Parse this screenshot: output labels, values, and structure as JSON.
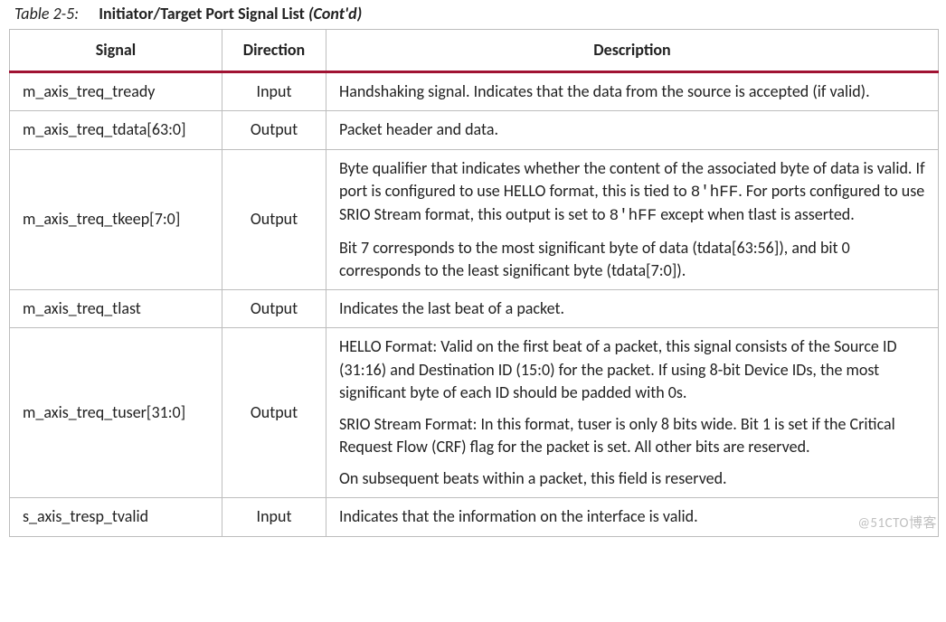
{
  "caption": {
    "label": "Table 2-5:",
    "title": "Initiator/Target Port Signal List",
    "contd": "(Cont'd)"
  },
  "headers": {
    "signal": "Signal",
    "direction": "Direction",
    "description": "Description"
  },
  "rows": [
    {
      "signal": "m_axis_treq_tready",
      "direction": "Input",
      "desc": [
        "Handshaking signal. Indicates that the data from the source is accepted (if valid)."
      ]
    },
    {
      "signal": "m_axis_treq_tdata[63:0]",
      "direction": "Output",
      "desc": [
        "Packet header and data."
      ]
    },
    {
      "signal": "m_axis_treq_tkeep[7:0]",
      "direction": "Output",
      "desc": [
        "Byte qualifier that indicates whether the content of the associated byte of data is valid. If port is configured to use HELLO format, this is tied to 8'hFF. For ports configured to use SRIO Stream format, this output is set to 8'hFF except when tlast is asserted.",
        "Bit 7 corresponds to the most significant byte of data (tdata[63:56]), and bit 0 corresponds to the least significant byte (tdata[7:0])."
      ]
    },
    {
      "signal": "m_axis_treq_tlast",
      "direction": "Output",
      "desc": [
        "Indicates the last beat of a packet."
      ]
    },
    {
      "signal": "m_axis_treq_tuser[31:0]",
      "direction": "Output",
      "desc": [
        "HELLO Format: Valid on the first beat of a packet, this signal consists of the Source ID (31:16) and Destination ID (15:0) for the packet. If using 8-bit Device IDs, the most significant byte of each ID should be padded with 0s.",
        "SRIO Stream Format: In this format, tuser is only 8 bits wide. Bit 1 is set if the Critical Request Flow (CRF) flag for the packet is set. All other bits are reserved.",
        "On subsequent beats within a packet, this field is reserved."
      ]
    },
    {
      "signal": "s_axis_tresp_tvalid",
      "direction": "Input",
      "desc": [
        "Indicates that the information on the interface is valid."
      ]
    }
  ],
  "watermark": "@51CTO博客"
}
